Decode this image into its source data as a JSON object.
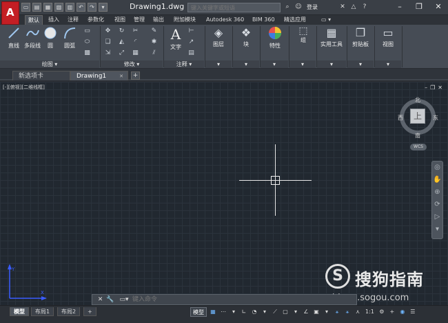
{
  "title": {
    "doc": "Drawing1.dwg",
    "search_placeholder": "键入关键字或短语",
    "login": "登录"
  },
  "ribbon_tabs": [
    "默认",
    "插入",
    "注释",
    "参数化",
    "视图",
    "管理",
    "输出",
    "附加模块",
    "Autodesk 360",
    "BIM 360",
    "精选应用"
  ],
  "ribbon": {
    "draw_tools": [
      "直线",
      "多段线",
      "圆",
      "圆弧"
    ],
    "draw_panel": "绘图",
    "modify_panel": "修改",
    "text_tool": "文字",
    "annot_panel": "注释",
    "big_tools": [
      "图层",
      "块",
      "特性",
      "组",
      "实用工具",
      "剪贴板",
      "视图"
    ]
  },
  "doc_tabs": [
    "新选项卡",
    "Drawing1"
  ],
  "viewport": {
    "label": "[-][俯视][二维线框]"
  },
  "viewcube": {
    "face": "上",
    "north": "北",
    "south": "南",
    "east": "东",
    "west": "西",
    "wcs": "WCS"
  },
  "command": {
    "placeholder": "键入命令"
  },
  "layout_tabs": [
    "模型",
    "布局1",
    "布局2"
  ],
  "status": {
    "model": "模型",
    "scale": "1:1"
  },
  "watermark": {
    "brand": "搜狗指南",
    "url": "zhinan.sogou.com"
  },
  "colors": {
    "accent_red": "#c41e24",
    "canvas_bg": "#212830",
    "ribbon_bg": "#464c55",
    "status_blue": "#6fb6ff"
  }
}
